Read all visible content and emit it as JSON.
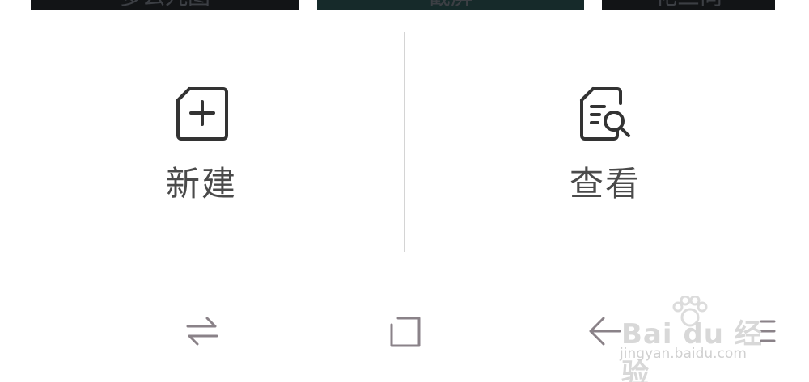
{
  "top_thumbnails": [
    {
      "label": "多么九图"
    },
    {
      "label": "截屏"
    },
    {
      "label": "花三向"
    }
  ],
  "actions": {
    "new": {
      "label": "新建",
      "icon": "new-document-icon"
    },
    "view": {
      "label": "查看",
      "icon": "search-document-icon"
    }
  },
  "navbar": {
    "switch_icon": "switch-arrows-icon",
    "home_icon": "square-home-icon",
    "back_icon": "back-arrow-icon",
    "menu_icon": "menu-icon"
  },
  "watermark": {
    "main": "Bai du 经验",
    "sub": "jingyan.baidu.com"
  },
  "colors": {
    "background": "#ffffff",
    "label_text": "#4a4a4a",
    "icon_stroke": "#333333",
    "nav_icon": "#8a8288",
    "divider": "#d4d4d4"
  }
}
